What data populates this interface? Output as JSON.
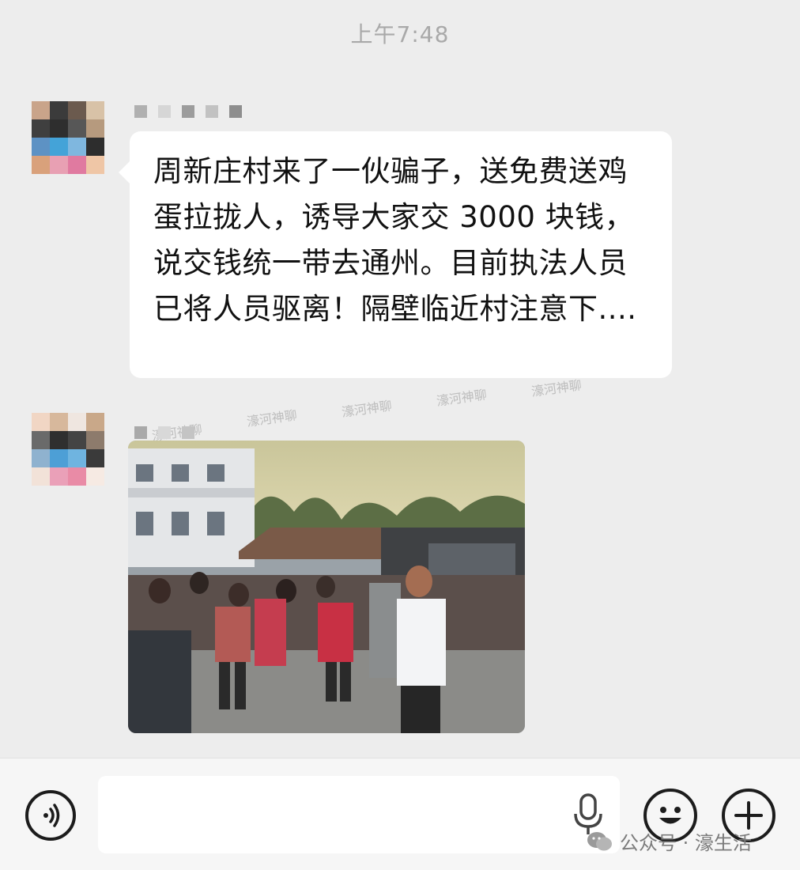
{
  "timestamp": "上午7:48",
  "messages": [
    {
      "type": "text",
      "text": "周新庄村来了一伙骗子，送免费送鸡蛋拉拢人，诱导大家交 3000 块钱，说交钱统一带去通州。目前执法人员已将人员驱离！隔壁临近村注意下...."
    },
    {
      "type": "image"
    }
  ],
  "watermarks": [
    "濠河神聊",
    "濠河神聊",
    "濠河神聊",
    "濠河神聊",
    "濠河神聊"
  ],
  "input_bar": {
    "voice_icon": "voice-icon",
    "mic_icon": "mic-icon",
    "emoji_icon": "emoji-icon",
    "plus_icon": "plus-icon"
  },
  "brand": {
    "label": "公众号 · 濠生活",
    "icon": "wechat-icon"
  },
  "colors": {
    "chat_bg": "#ededed",
    "bubble_bg": "#ffffff",
    "timestamp": "#a9a9a9",
    "watermark": "#bdbdbd"
  }
}
